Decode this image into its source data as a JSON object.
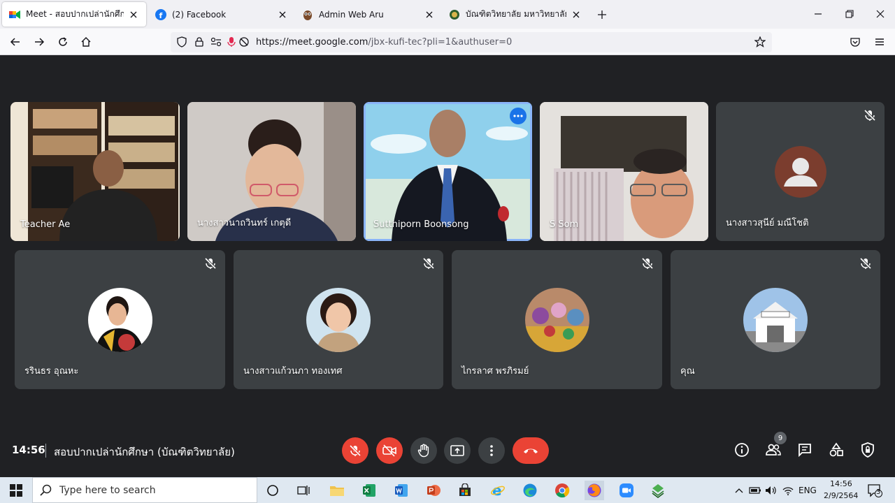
{
  "browser": {
    "tabs": [
      {
        "title": "Meet - สอบปากเปล่านักศึกษา (บัณ",
        "active": true
      },
      {
        "title": "(2) Facebook",
        "active": false
      },
      {
        "title": "Admin Web Aru",
        "active": false
      },
      {
        "title": "บัณฑิตวิทยาลัย มหาวิทยาลัยราช",
        "active": false
      }
    ],
    "url_host": "https://meet.google.com",
    "url_path": "/jbx-kufi-tec?pli=1&authuser=0"
  },
  "meet": {
    "participants_row1": [
      {
        "name": "Teacher Ae",
        "muted": false
      },
      {
        "name": "นางสาวนาถวินทร์ เกตุดี",
        "muted": false
      },
      {
        "name": "Sutthiporn Boonsong",
        "muted": false,
        "active": true
      },
      {
        "name": "S Som",
        "muted": false
      },
      {
        "name": "นางสาวสุนีย์ มณีโชติ",
        "muted": true
      }
    ],
    "participants_row2": [
      {
        "name": "รรินธร อุณหะ",
        "muted": true
      },
      {
        "name": "นางสาวแก้วนภา ทองเทศ",
        "muted": true
      },
      {
        "name": "ไกรลาศ พรภิรมย์",
        "muted": true
      },
      {
        "name": "คุณ",
        "muted": true
      }
    ],
    "time": "14:56",
    "meeting_title": "สอบปากเปล่านักศึกษา (บัณฑิตวิทยาลัย)",
    "people_count": "9"
  },
  "taskbar": {
    "search_placeholder": "Type here to search",
    "language": "ENG",
    "time": "14:56",
    "date": "2/9/2564",
    "notifications": "3"
  }
}
